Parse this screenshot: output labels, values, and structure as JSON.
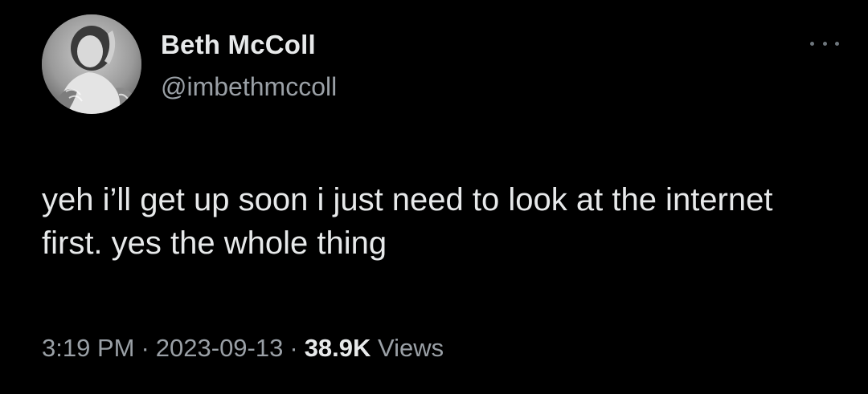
{
  "author": {
    "name": "Beth McColl",
    "handle": "@imbethmccoll"
  },
  "tweet": {
    "text": "yeh i’ll get up soon i just need to look at the internet first. yes the whole thing"
  },
  "meta": {
    "time": "3:19 PM",
    "separator": "·",
    "date": "2023-09-13",
    "views_count": "38.9K",
    "views_label": "Views"
  },
  "icons": {
    "more": "more-options-icon"
  },
  "colors": {
    "background": "#000000",
    "primary_text": "#e7e9ea",
    "secondary_text": "#9aa0a6"
  }
}
